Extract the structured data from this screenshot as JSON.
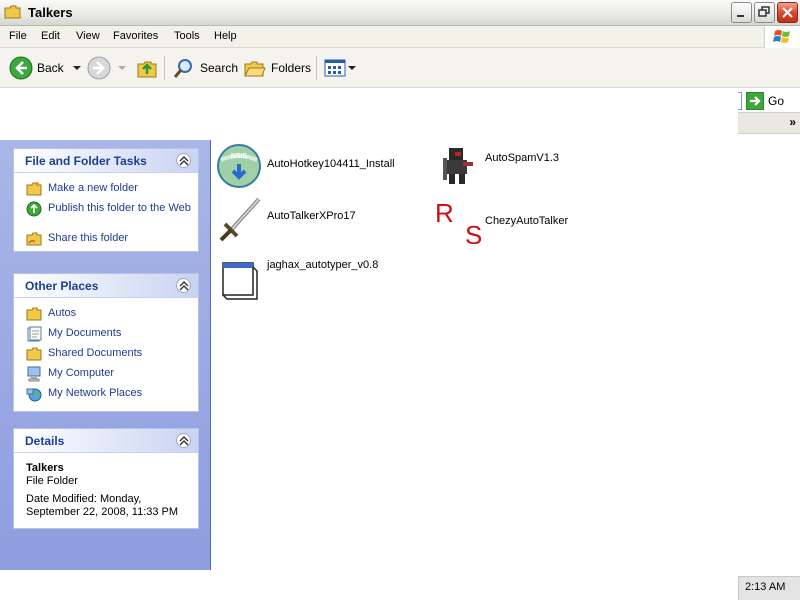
{
  "window": {
    "title": "Talkers"
  },
  "menu": [
    "File",
    "Edit",
    "View",
    "Favorites",
    "Tools",
    "Help"
  ],
  "toolbar": {
    "back_label": "Back",
    "search_label": "Search",
    "folders_label": "Folders"
  },
  "address": {
    "go_label": "Go",
    "links_chevron": "»"
  },
  "panels": {
    "file_tasks": {
      "title": "File and Folder Tasks",
      "items": [
        "Make a new folder",
        "Publish this folder to the Web",
        "Share this folder"
      ]
    },
    "other_places": {
      "title": "Other Places",
      "items": [
        "Autos",
        "My Documents",
        "Shared Documents",
        "My Computer",
        "My Network Places"
      ]
    },
    "details": {
      "title": "Details",
      "name": "Talkers",
      "type": "File Folder",
      "modified_line1": "Date Modified: Monday,",
      "modified_line2": "September 22, 2008, 11:33 PM"
    }
  },
  "files": [
    {
      "name": "AutoHotkey104411_Install",
      "icon": "installer-icon"
    },
    {
      "name": "AutoSpamV1.3",
      "icon": "character-icon"
    },
    {
      "name": "AutoTalkerXPro17",
      "icon": "sword-icon"
    },
    {
      "name": "ChezyAutoTalker",
      "icon": "rs-icon"
    },
    {
      "name": "jaghax_autotyper_v0.8",
      "icon": "window-app-icon"
    }
  ],
  "rs_icon_letters": {
    "top": "R",
    "bottom": "S"
  },
  "installer_badge": "NSIS",
  "tray": {
    "clock": "2:13 AM"
  },
  "colors": {
    "close_button": "#d9452d",
    "task_link": "#1e3c8f",
    "pane_background": "#8d9ddf"
  }
}
